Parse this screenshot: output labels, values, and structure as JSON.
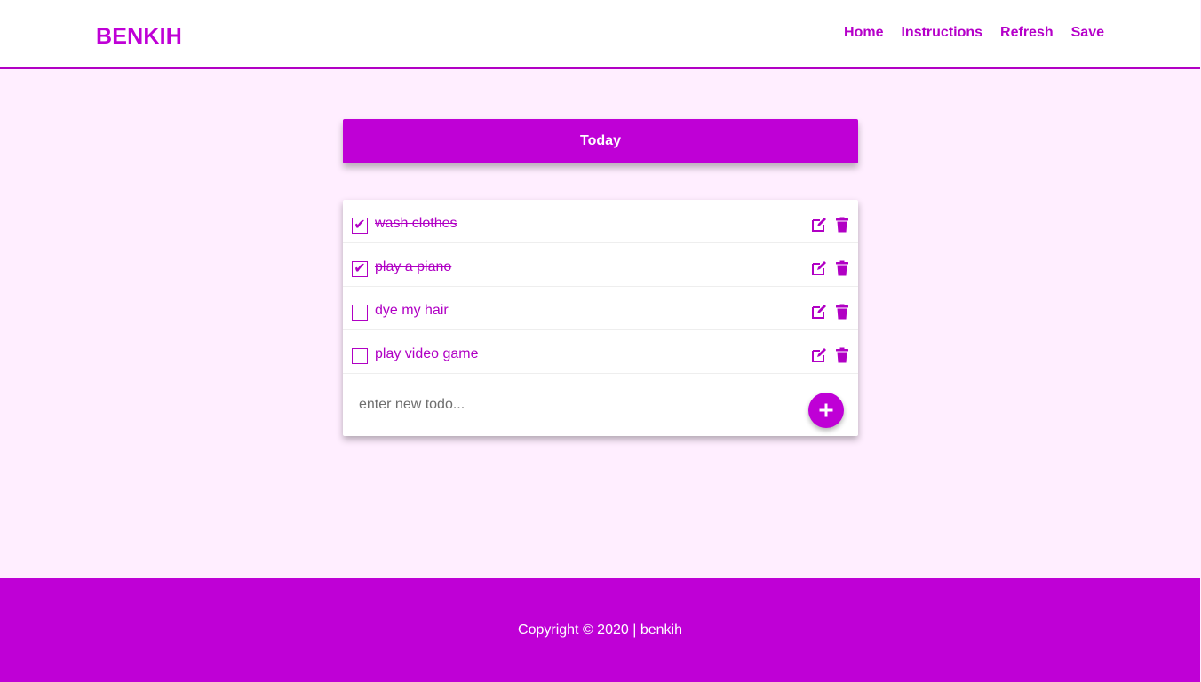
{
  "header": {
    "brand": "BENKIH",
    "nav": [
      {
        "label": "Home"
      },
      {
        "label": "Instructions"
      },
      {
        "label": "Refresh"
      },
      {
        "label": "Save"
      }
    ]
  },
  "list": {
    "title": "Today",
    "items": [
      {
        "text": "wash clothes",
        "done": true,
        "check_mark": "✔"
      },
      {
        "text": "play a piano",
        "done": true,
        "check_mark": "✔"
      },
      {
        "text": "dye my hair",
        "done": false,
        "check_mark": ""
      },
      {
        "text": "play video game",
        "done": false,
        "check_mark": ""
      }
    ],
    "new_todo_placeholder": "enter new todo...",
    "new_todo_value": ""
  },
  "footer": {
    "text": "Copyright © 2020 | benkih"
  },
  "colors": {
    "accent": "#bf00d6",
    "background": "#ffeeff",
    "text_accent": "#b000c4"
  },
  "icons": {
    "edit": "edit-icon",
    "delete": "trash-icon",
    "add": "plus-icon"
  }
}
